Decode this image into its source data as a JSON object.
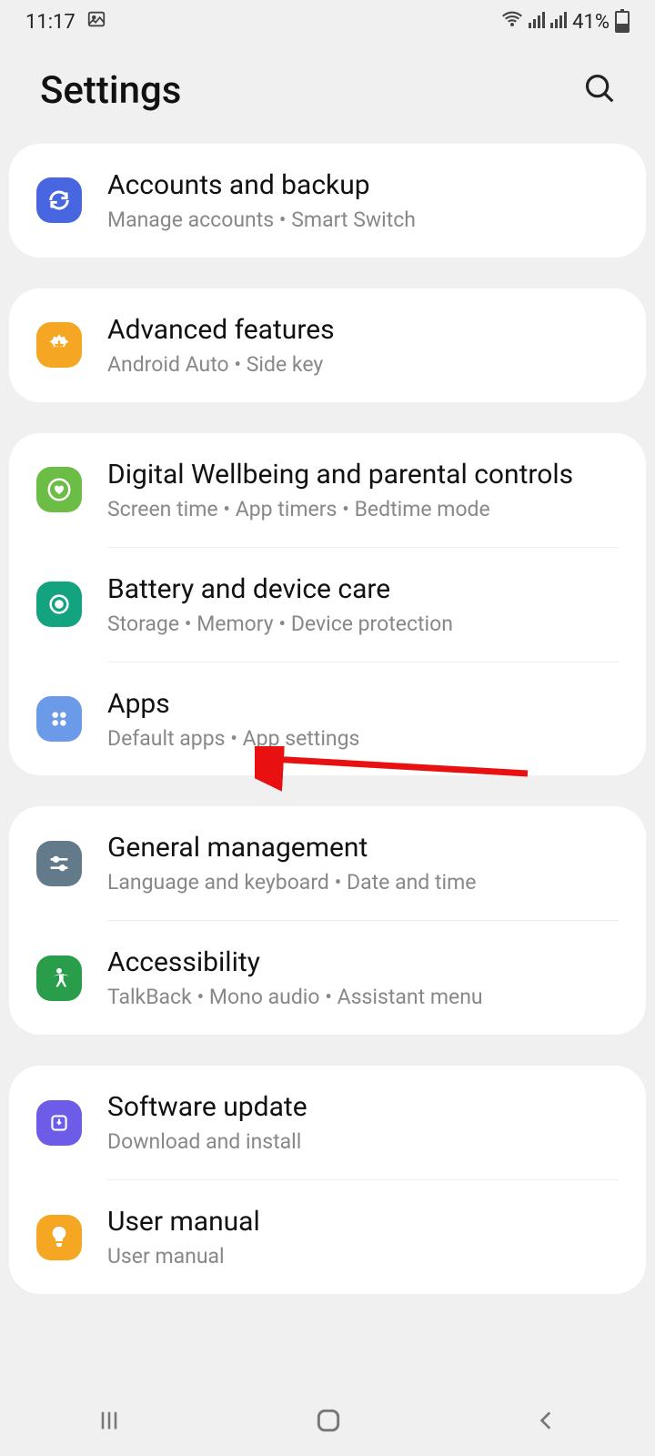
{
  "status": {
    "time": "11:17",
    "battery_pct": "41%"
  },
  "header": {
    "title": "Settings"
  },
  "groups": [
    {
      "items": [
        {
          "icon_bg": "#4866e0",
          "title": "Accounts and backup",
          "subtitle": "Manage accounts  •  Smart Switch"
        }
      ]
    },
    {
      "items": [
        {
          "icon_bg": "#f5a623",
          "title": "Advanced features",
          "subtitle": "Android Auto  •  Side key"
        }
      ]
    },
    {
      "items": [
        {
          "icon_bg": "#6bbd45",
          "title": "Digital Wellbeing and parental controls",
          "subtitle": "Screen time  •  App timers  •  Bedtime mode"
        },
        {
          "icon_bg": "#14a37f",
          "title": "Battery and device care",
          "subtitle": "Storage  •  Memory  •  Device protection"
        },
        {
          "icon_bg": "#6b9ae8",
          "title": "Apps",
          "subtitle": "Default apps  •  App settings"
        }
      ]
    },
    {
      "items": [
        {
          "icon_bg": "#627a8a",
          "title": "General management",
          "subtitle": "Language and keyboard  •  Date and time"
        },
        {
          "icon_bg": "#2a9d4a",
          "title": "Accessibility",
          "subtitle": "TalkBack  •  Mono audio  •  Assistant menu"
        }
      ]
    },
    {
      "items": [
        {
          "icon_bg": "#6c5ce7",
          "title": "Software update",
          "subtitle": "Download and install"
        },
        {
          "icon_bg": "#f5a623",
          "title": "User manual",
          "subtitle": "User manual"
        }
      ]
    }
  ]
}
